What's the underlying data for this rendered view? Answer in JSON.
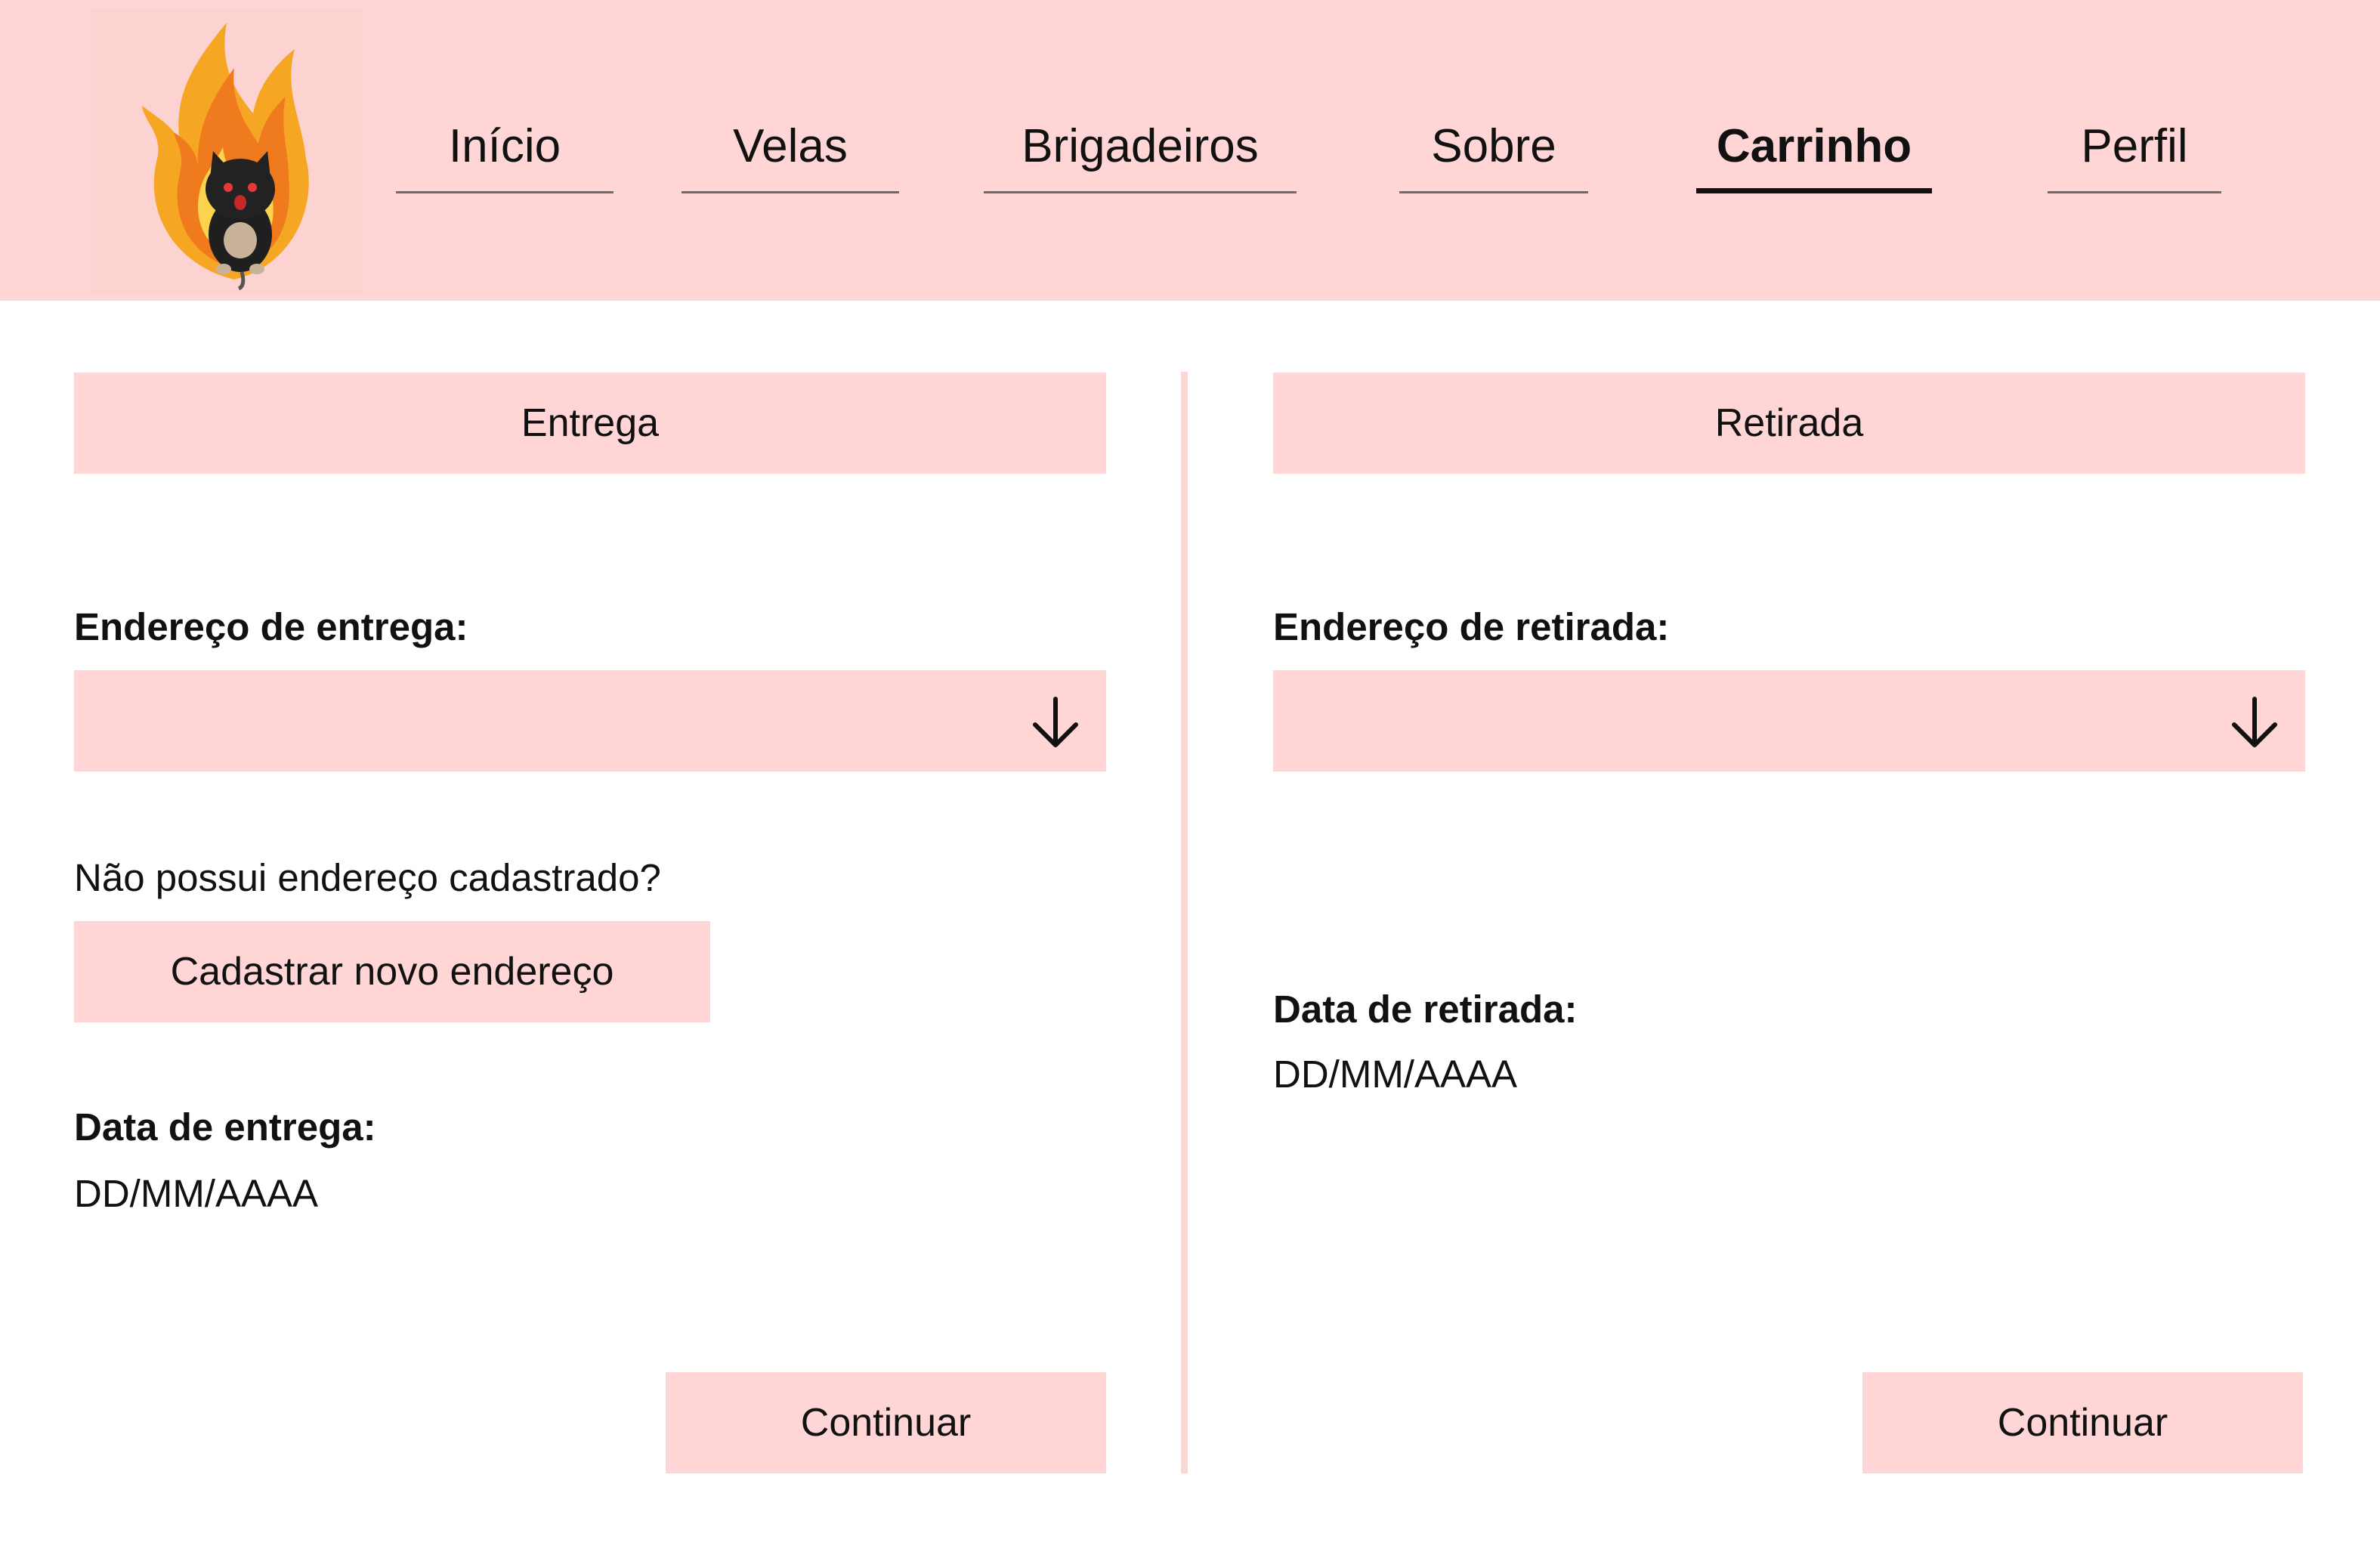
{
  "nav": {
    "items": [
      {
        "label": "Início",
        "active": false
      },
      {
        "label": "Velas",
        "active": false
      },
      {
        "label": "Brigadeiros",
        "active": false
      },
      {
        "label": "Sobre",
        "active": false
      },
      {
        "label": "Carrinho",
        "active": true
      },
      {
        "label": "Perfil",
        "active": false
      }
    ]
  },
  "delivery": {
    "tab_label": "Entrega",
    "address_label": "Endereço de entrega:",
    "address_value": "",
    "no_address_text": "Não possui endereço cadastrado?",
    "register_button": "Cadastrar novo endereço",
    "date_label": "Data de entrega:",
    "date_placeholder": "DD/MM/AAAA",
    "continue_button": "Continuar"
  },
  "pickup": {
    "tab_label": "Retirada",
    "address_label": "Endereço de retirada:",
    "address_value": "",
    "date_label": "Data de retirada:",
    "date_placeholder": "DD/MM/AAAA",
    "continue_button": "Continuar"
  },
  "icons": {
    "logo": "flaming-cat-logo",
    "dropdown": "arrow-down-icon"
  },
  "colors": {
    "accent_pink": "#ffd6d5",
    "text": "#111111",
    "background": "#ffffff"
  }
}
